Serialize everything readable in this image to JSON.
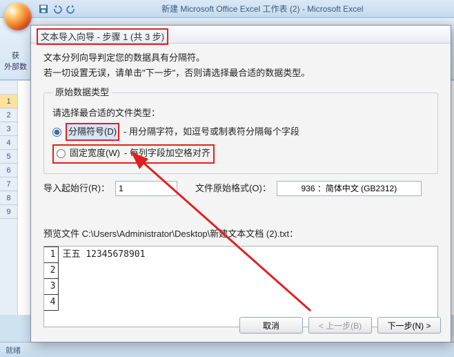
{
  "excel": {
    "title": "新建 Microsoft Office Excel 工作表 (2) - Microsoft Excel",
    "ribbon_get": "获",
    "ribbon_ext": "外部数",
    "status": "就绪",
    "rows": [
      "",
      "1",
      "2",
      "3",
      "4",
      "5",
      "6",
      "7",
      "8",
      "9"
    ]
  },
  "dialog": {
    "title": "文本导入向导 - 步骤 1 (共 3 步)",
    "intro1": "文本分列向导判定您的数据具有分隔符。",
    "intro2": "若一切设置无误，请单击\"下一步\"，否则请选择最合适的数据类型。",
    "group_legend": "原始数据类型",
    "choose_prompt": "请选择最合适的文件类型：",
    "radio1_label": "分隔符号(D)",
    "radio1_desc": " - 用分隔字符，如逗号或制表符分隔每个字段",
    "radio2_label": "固定宽度(W)",
    "radio2_desc": " - 每列字段加空格对齐",
    "start_row_label": "导入起始行(R)：",
    "start_row_value": "1",
    "origin_label": "文件原始格式(O)：",
    "origin_value": "936 ：简体中文 (GB2312)",
    "preview_label": "预览文件 C:\\Users\\Administrator\\Desktop\\新建文本文档 (2).txt：",
    "preview_rows": [
      {
        "n": "1",
        "t": "王五 12345678901"
      },
      {
        "n": "2",
        "t": ""
      },
      {
        "n": "3",
        "t": ""
      },
      {
        "n": "4",
        "t": ""
      }
    ],
    "btn_cancel": "取消",
    "btn_back": "< 上一步(B)",
    "btn_next": "下一步(N) >"
  }
}
